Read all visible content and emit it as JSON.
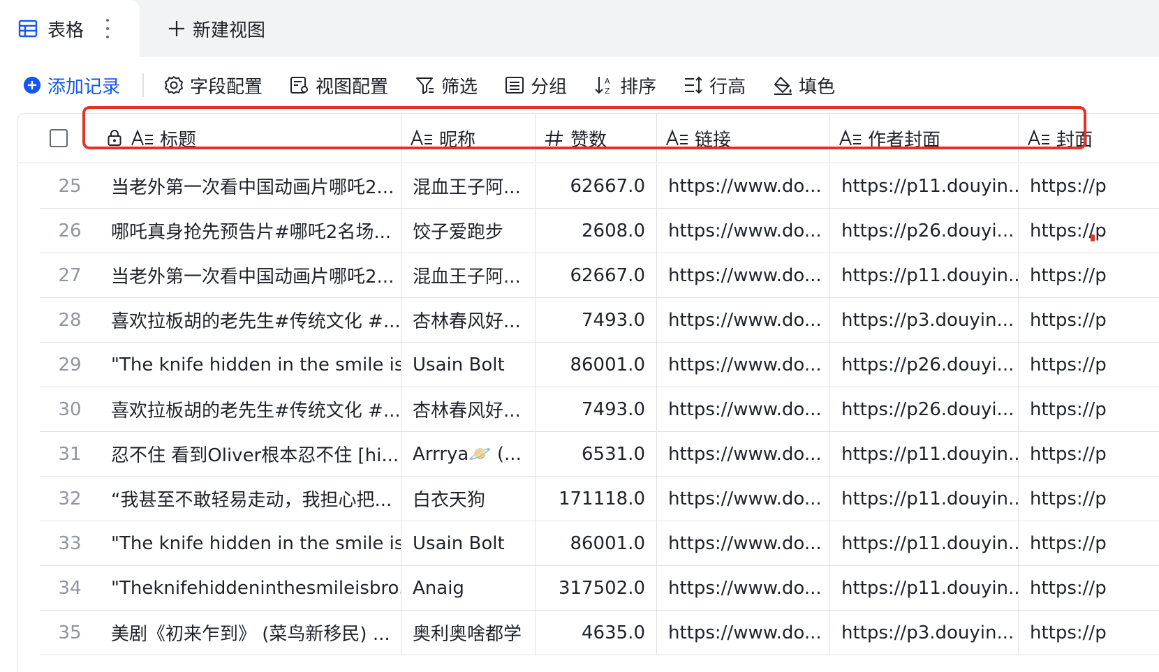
{
  "tabs": {
    "active_label": "表格",
    "new_view_label": "新建视图"
  },
  "toolbar": {
    "add_record": "添加记录",
    "field_config": "字段配置",
    "view_config": "视图配置",
    "filter": "筛选",
    "group": "分组",
    "sort": "排序",
    "row_height": "行高",
    "fill_color": "填色"
  },
  "columns": [
    {
      "key": "title",
      "label": "标题",
      "type": "text",
      "locked": true
    },
    {
      "key": "nickname",
      "label": "昵称",
      "type": "text"
    },
    {
      "key": "likes",
      "label": "赞数",
      "type": "number"
    },
    {
      "key": "link",
      "label": "链接",
      "type": "text"
    },
    {
      "key": "author_cover",
      "label": "作者封面",
      "type": "text"
    },
    {
      "key": "cover",
      "label": "封面",
      "type": "text"
    }
  ],
  "rows": [
    {
      "num": "25",
      "title": "当老外第一次看中国动画片哪吒2...",
      "nickname": "混血王子阿...",
      "likes": "62667.0",
      "link": "https://www.do...",
      "author_cover": "https://p11.douyin...",
      "cover": "https://p"
    },
    {
      "num": "26",
      "title": "哪吒真身抢先预告片#哪吒2名场...",
      "nickname": "饺子爱跑步",
      "likes": "2608.0",
      "link": "https://www.do...",
      "author_cover": "https://p26.douyi...",
      "cover": "https://p"
    },
    {
      "num": "27",
      "title": "当老外第一次看中国动画片哪吒2...",
      "nickname": "混血王子阿...",
      "likes": "62667.0",
      "link": "https://www.do...",
      "author_cover": "https://p11.douyin...",
      "cover": "https://p"
    },
    {
      "num": "28",
      "title": "喜欢拉板胡的老先生#传统文化 #...",
      "nickname": "杏林春风好...",
      "likes": "7493.0",
      "link": "https://www.do...",
      "author_cover": "https://p3.douyin...",
      "cover": "https://p"
    },
    {
      "num": "29",
      "title": "\"The knife hidden in the smile is...",
      "nickname": "Usain Bolt",
      "likes": "86001.0",
      "link": "https://www.do...",
      "author_cover": "https://p26.douyi...",
      "cover": "https://p"
    },
    {
      "num": "30",
      "title": "喜欢拉板胡的老先生#传统文化 #...",
      "nickname": "杏林春风好...",
      "likes": "7493.0",
      "link": "https://www.do...",
      "author_cover": "https://p26.douyi...",
      "cover": "https://p"
    },
    {
      "num": "31",
      "title": "忍不住 看到Oliver根本忍不住 [hi...",
      "nickname": "Arrrya🪐 (...",
      "likes": "6531.0",
      "link": "https://www.do...",
      "author_cover": "https://p11.douyin...",
      "cover": "https://p"
    },
    {
      "num": "32",
      "title": "“我甚至不敢轻易走动，我担心把...",
      "nickname": "白衣天狗",
      "likes": "171118.0",
      "link": "https://www.do...",
      "author_cover": "https://p11.douyin...",
      "cover": "https://p"
    },
    {
      "num": "33",
      "title": "\"The knife hidden in the smile is...",
      "nickname": "Usain Bolt",
      "likes": "86001.0",
      "link": "https://www.do...",
      "author_cover": "https://p11.douyin...",
      "cover": "https://p"
    },
    {
      "num": "34",
      "title": "\"Theknifehiddeninthesmileisbro...",
      "nickname": "Anaig",
      "likes": "317502.0",
      "link": "https://www.do...",
      "author_cover": "https://p11.douyin...",
      "cover": "https://p"
    },
    {
      "num": "35",
      "title": "美剧《初来乍到》 (菜鸟新移民) ...",
      "nickname": "奥利奥啥都学",
      "likes": "4635.0",
      "link": "https://www.do...",
      "author_cover": "https://p3.douyin...",
      "cover": "https://p"
    }
  ],
  "colors": {
    "accent": "#1456f0",
    "highlight": "#e53224",
    "border": "#dee0e3",
    "tabbar_bg": "#f2f3f5"
  },
  "icons": {
    "table_tab": "table-grid-icon",
    "more": "vertical-dots-icon",
    "new_view": "plus-icon",
    "add_record": "plus-circle-icon",
    "field_config": "gear-icon",
    "view_config": "view-settings-icon",
    "filter": "funnel-icon",
    "group": "group-list-icon",
    "sort": "sort-icon",
    "row_height": "row-height-icon",
    "fill": "paint-bucket-icon",
    "text_field": "text-field-icon",
    "number_field": "hash-icon",
    "lock": "lock-icon"
  }
}
